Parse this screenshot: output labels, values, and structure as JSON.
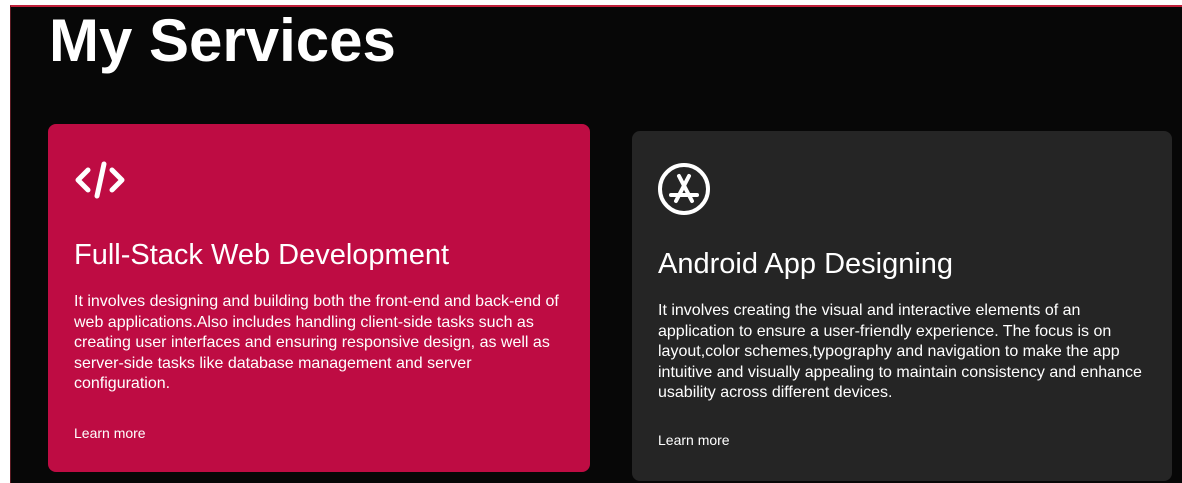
{
  "page": {
    "title": "My Services"
  },
  "services": [
    {
      "icon": "code-icon",
      "title": "Full-Stack Web Development",
      "description": "It involves designing and building both the front-end and back-end of web applications.Also includes handling client-side tasks such as creating user interfaces and ensuring responsive design, as well as server-side tasks like database management and server configuration.",
      "link_label": "Learn more",
      "background": "#be0c43"
    },
    {
      "icon": "app-store-icon",
      "title": "Android App Designing",
      "description": "It involves creating the visual and interactive elements of an application to ensure a user-friendly experience. The focus is on layout,color schemes,typography and navigation to make the app intuitive and visually appealing to maintain consistency and enhance usability across different devices.",
      "link_label": "Learn more",
      "background": "#252525"
    }
  ],
  "colors": {
    "page_background": "#070707",
    "accent": "#be0c43",
    "card_dark": "#252525",
    "text": "#ffffff"
  }
}
